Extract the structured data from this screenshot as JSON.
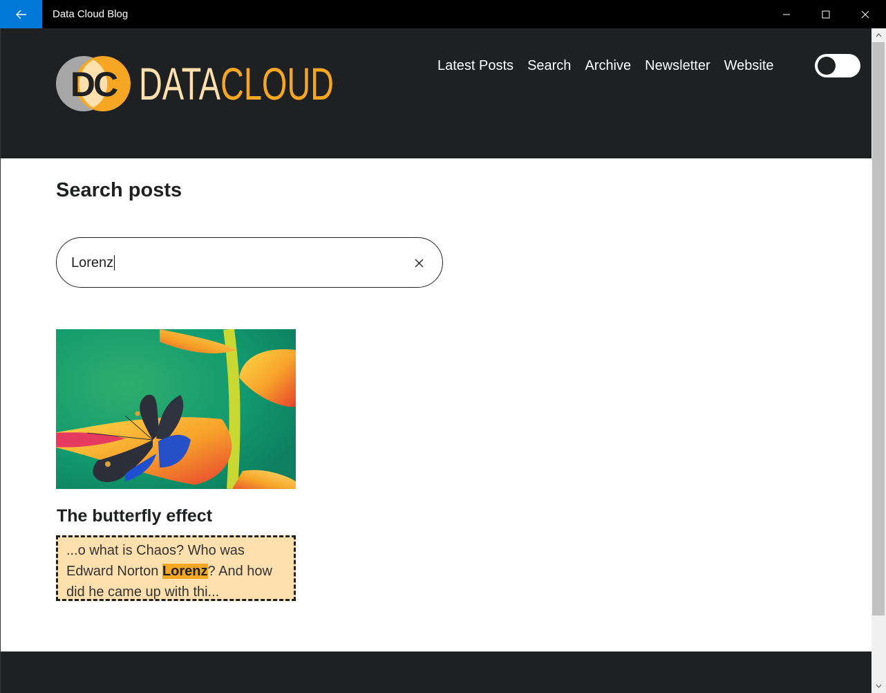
{
  "window": {
    "title": "Data Cloud Blog",
    "accent_color": "#0078d7"
  },
  "brand": {
    "logo_mark": "DC",
    "name_part1": "DATA",
    "name_part2": "CLOUD",
    "color_light": "#fde0ae",
    "color_orange": "#f5a623"
  },
  "nav": {
    "items": [
      "Latest Posts",
      "Search",
      "Archive",
      "Newsletter",
      "Website"
    ]
  },
  "theme_toggle": {
    "state": "off"
  },
  "search": {
    "heading": "Search posts",
    "value": "Lorenz"
  },
  "results": [
    {
      "title": "The butterfly effect",
      "excerpt_before": "...o what is Chaos? Who was Edward Norton ",
      "excerpt_highlight": "Lorenz",
      "excerpt_after": "? And how did he came up with thi...",
      "image_icon": "butterfly-on-flower-photo"
    }
  ]
}
